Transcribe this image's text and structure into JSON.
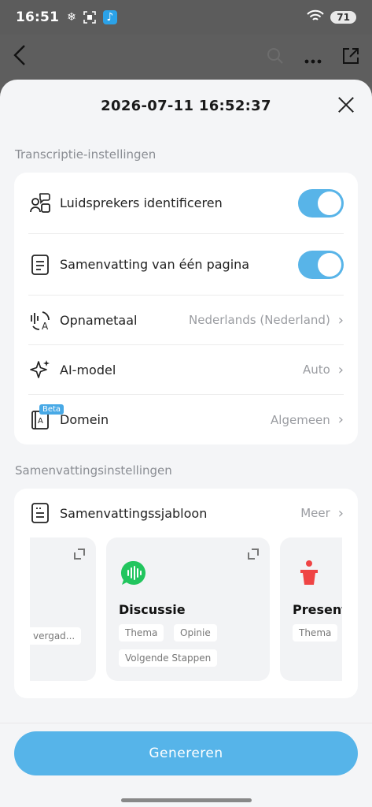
{
  "status_bar": {
    "time": "16:51",
    "battery": "71",
    "signal_label": "6"
  },
  "bg_header": {
    "back_icon": "back-chevron-icon",
    "tools": [
      "search-icon",
      "more-icon",
      "share-icon"
    ]
  },
  "sheet": {
    "title": "2026-07-11 16:52:37"
  },
  "transcription": {
    "section_label": "Transcriptie-instellingen",
    "items": [
      {
        "label": "Luidsprekers identificeren",
        "type": "toggle",
        "on": true,
        "icon": "speakers-icon"
      },
      {
        "label": "Samenvatting van één pagina",
        "type": "toggle",
        "on": true,
        "icon": "document-icon"
      },
      {
        "label": "Opnametaal",
        "value": "Nederlands (Nederland)",
        "type": "select",
        "icon": "language-icon"
      },
      {
        "label": "AI-model",
        "value": "Auto",
        "type": "select",
        "icon": "sparkle-icon"
      },
      {
        "label": "Domein",
        "value": "Algemeen",
        "type": "select",
        "icon": "book-icon",
        "badge": "Beta"
      }
    ]
  },
  "summary": {
    "section_label": "Samenvattingsinstellingen",
    "template_label": "Samenvattingssjabloon",
    "more_label": "Meer",
    "templates": [
      {
        "title": "",
        "tags": [
          "vergad..."
        ]
      },
      {
        "title": "Discussie",
        "tags": [
          "Thema",
          "Opinie",
          "Volgende Stappen"
        ]
      },
      {
        "title": "Present",
        "tags": [
          "Thema"
        ]
      }
    ]
  },
  "footer": {
    "generate_label": "Genereren"
  },
  "colors": {
    "accent": "#56b4e9",
    "green": "#22c55e",
    "red": "#ef4444"
  }
}
